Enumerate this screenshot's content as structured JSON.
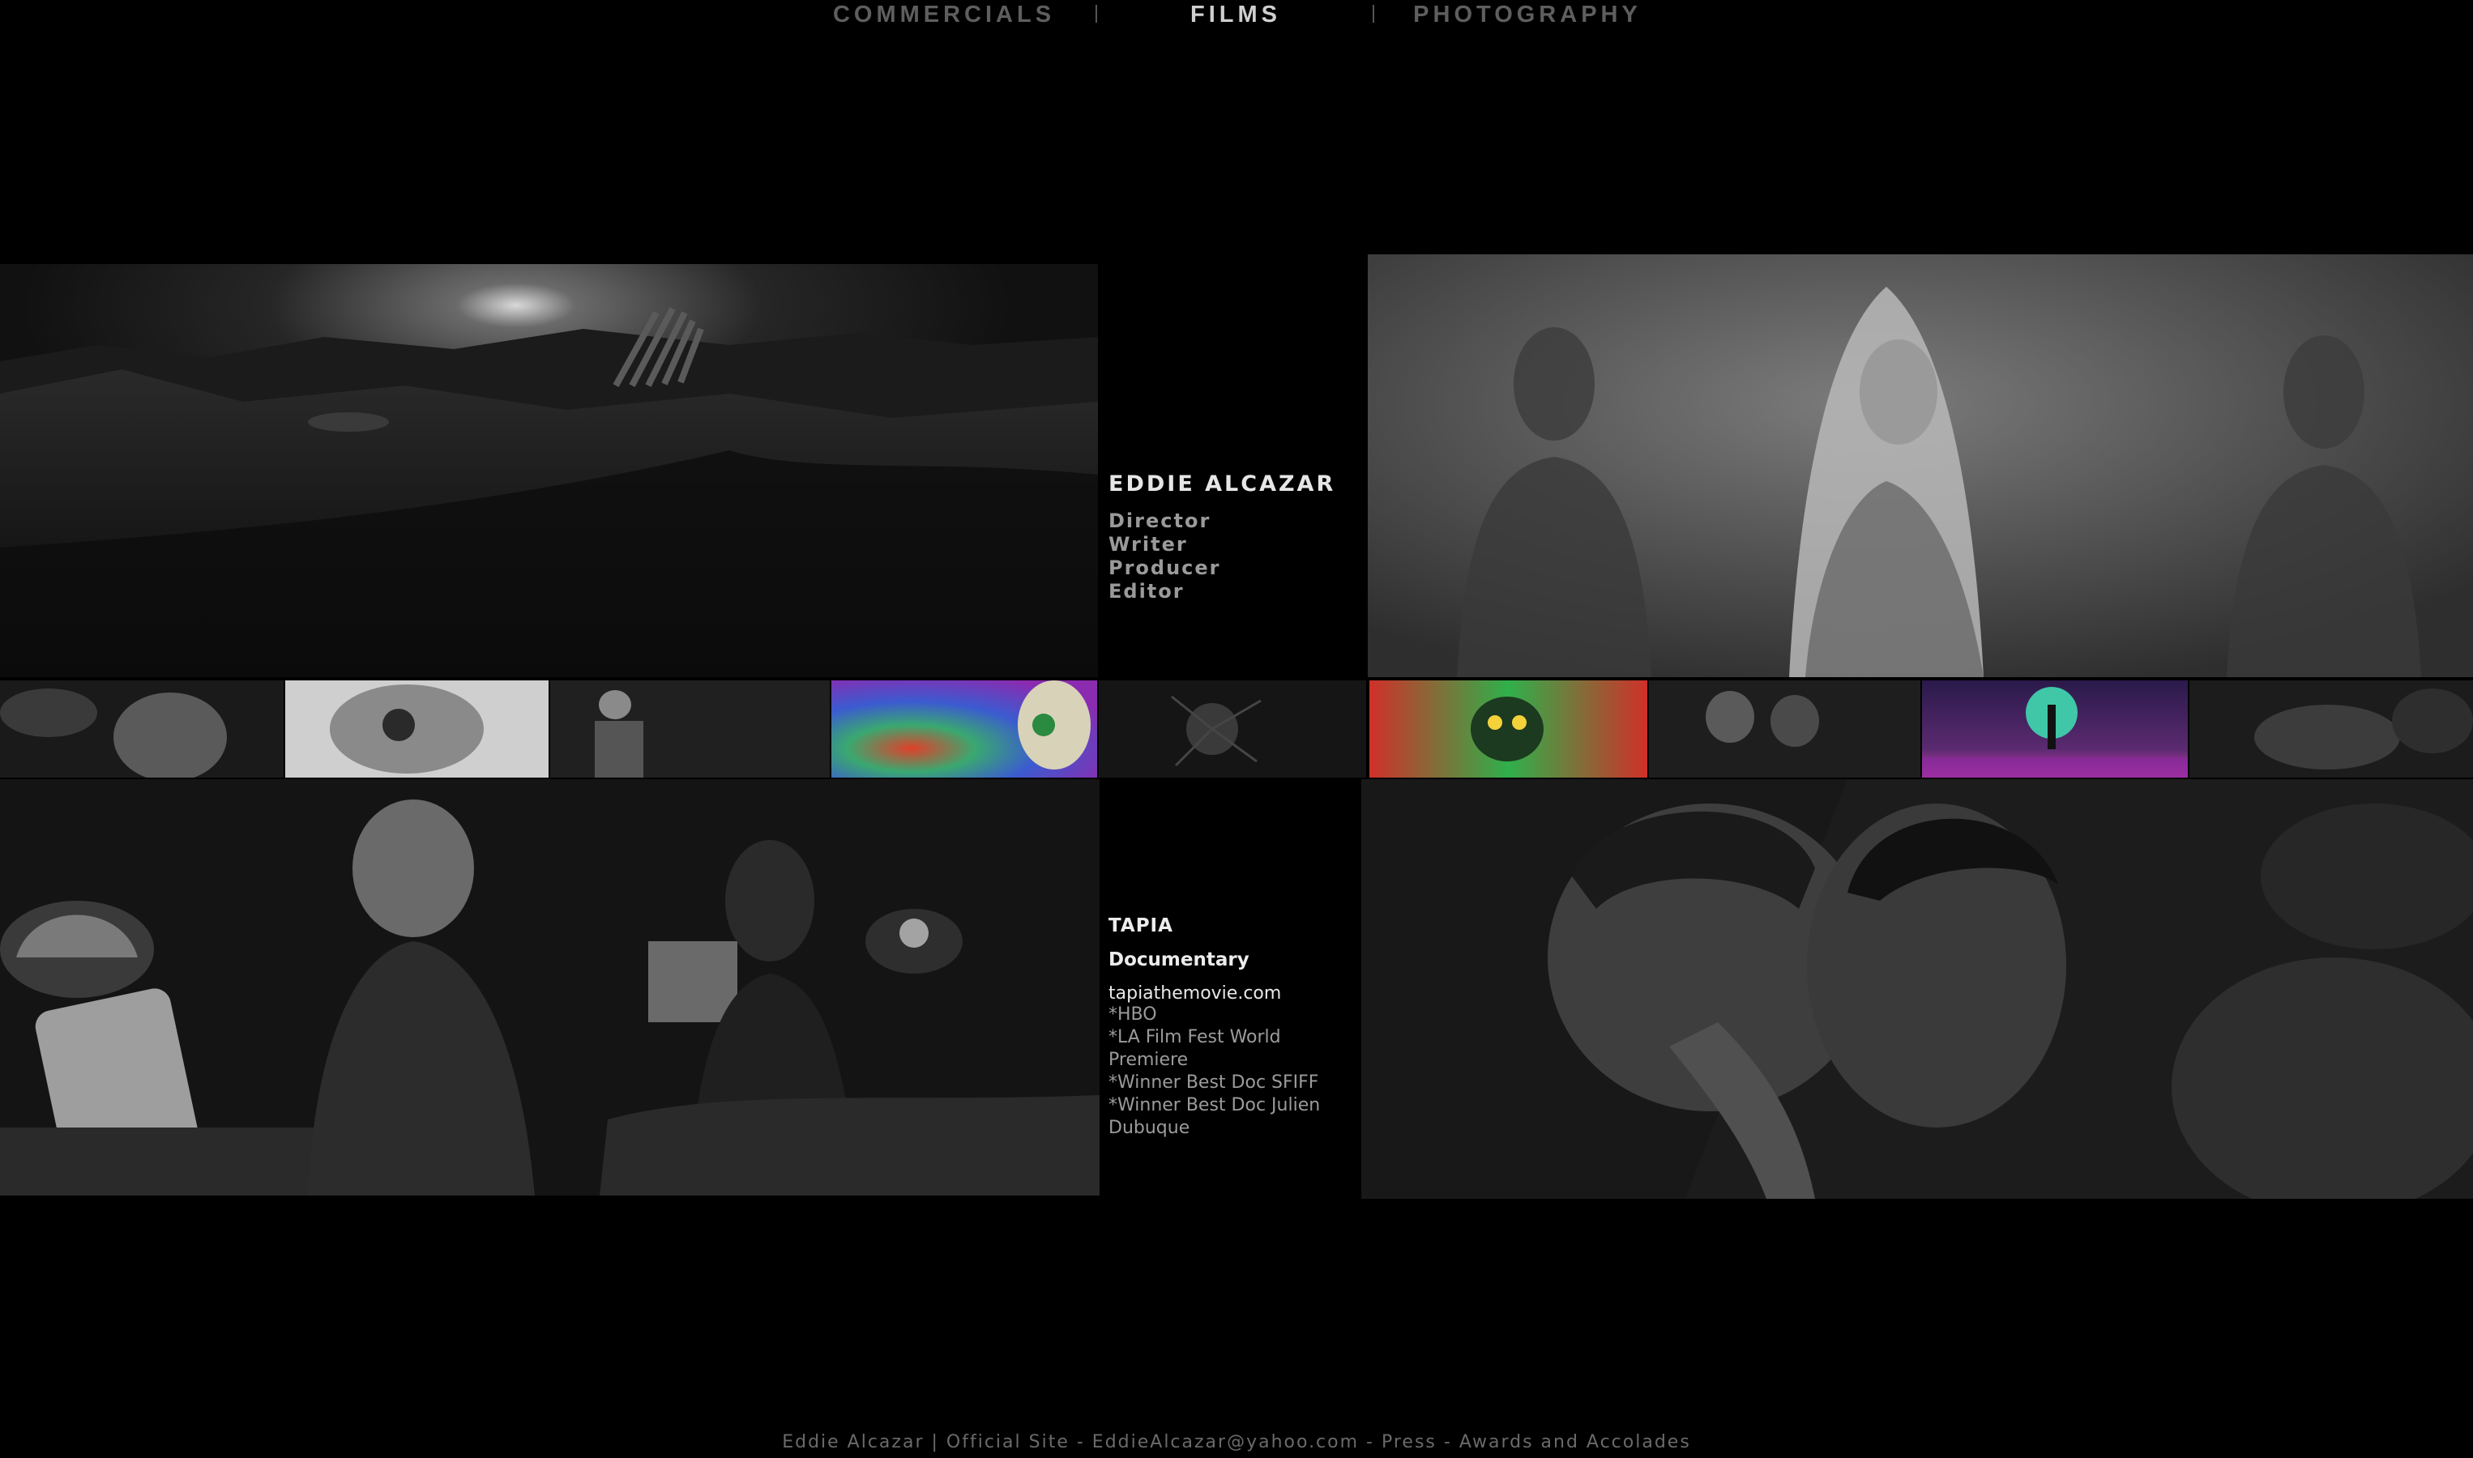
{
  "nav": {
    "commercials": "COMMERCIALS",
    "separator": "|",
    "films": "FILMS",
    "photography": "PHOTOGRAPHY"
  },
  "profile": {
    "name": "EDDIE ALCAZAR",
    "roles": [
      "Director",
      "Writer",
      "Producer",
      "Editor"
    ]
  },
  "film": {
    "title": "TAPIA",
    "genre": "Documentary",
    "link": "tapiathemovie.com",
    "notes": [
      "*HBO",
      "*LA Film Fest World Premiere",
      "*Winner Best Doc SFIFF",
      "*Winner Best Doc Julien Dubuque"
    ]
  },
  "footer": {
    "name": "Eddie Alcazar",
    "sep1": " | ",
    "site": "Official Site",
    "sep2": " - ",
    "email": "EddieAlcazar@yahoo.com",
    "sep3": " - ",
    "press": "Press",
    "sep4": " - ",
    "awards": "Awards and Accolades"
  },
  "colors": {
    "background": "#000000",
    "nav_active": "#cfcfcf",
    "nav_inactive": "#5e5e5e",
    "accent_teal": "#3fc7a8"
  }
}
